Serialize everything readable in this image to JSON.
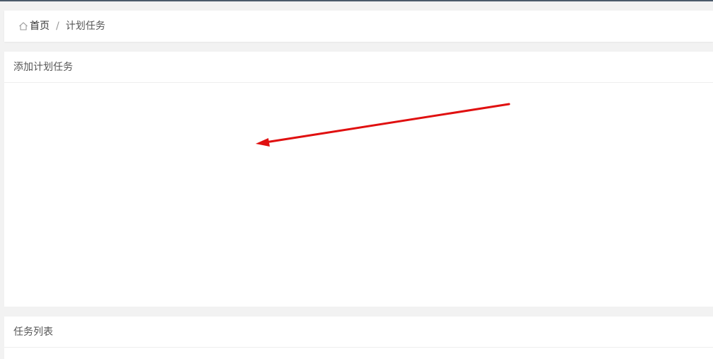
{
  "breadcrumb": {
    "home_label": "首页",
    "separator": "/",
    "current": "计划任务"
  },
  "add_task_panel": {
    "title": "添加计划任务"
  },
  "task_list_panel": {
    "title": "任务列表"
  },
  "annotation": {
    "arrow_color": "#e01010",
    "arrow_icon": "red-arrow-annotation"
  }
}
